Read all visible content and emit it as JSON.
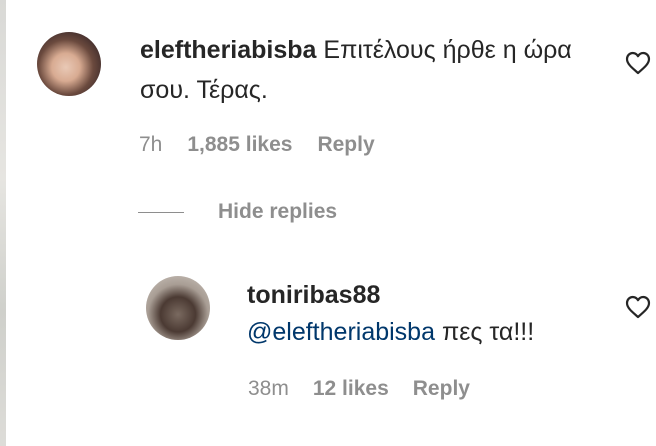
{
  "comments": [
    {
      "username": "eleftheriabisba",
      "text": "Επιτέλους ήρθε η ώρα σου. Τέρας.",
      "time": "7h",
      "likes": "1,885 likes",
      "reply_label": "Reply",
      "like_icon": "heart-outline-icon"
    }
  ],
  "thread": {
    "hide_replies_label": "Hide replies"
  },
  "replies": [
    {
      "username": "toniribas88",
      "mention": "@eleftheriabisba",
      "text": "πες τα!!!",
      "time": "38m",
      "likes": "12 likes",
      "reply_label": "Reply",
      "like_icon": "heart-outline-icon"
    }
  ],
  "colors": {
    "text": "#262626",
    "meta": "#8e8e8e",
    "mention": "#00376b"
  }
}
